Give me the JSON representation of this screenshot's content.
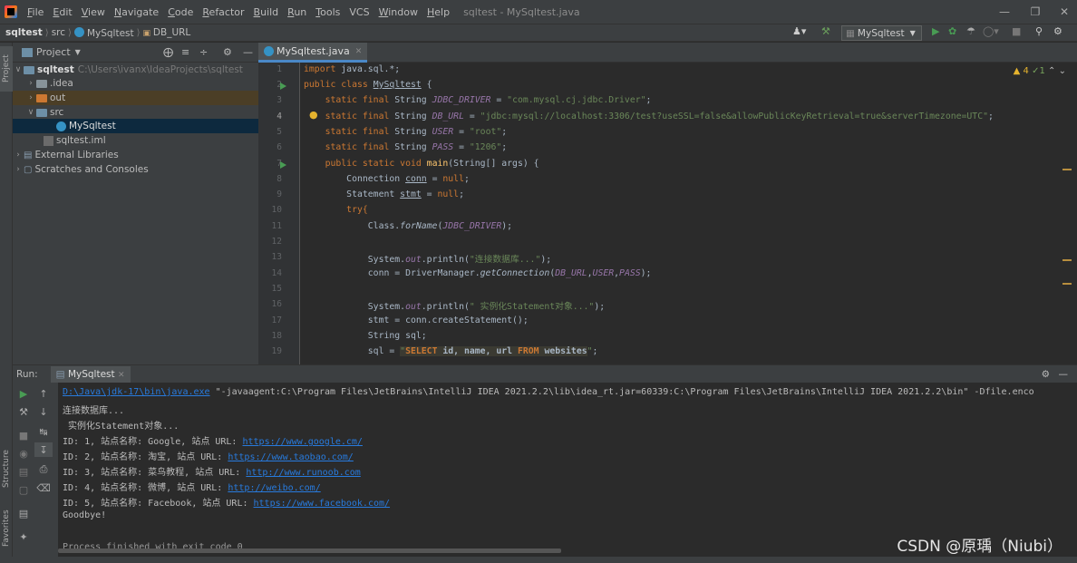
{
  "menubar": {
    "items": [
      "File",
      "Edit",
      "View",
      "Navigate",
      "Code",
      "Refactor",
      "Build",
      "Run",
      "Tools",
      "VCS",
      "Window",
      "Help"
    ],
    "title": "sqltest - MySqltest.java"
  },
  "navbar": {
    "project": "sqltest",
    "src": "src",
    "cls": "MySqltest",
    "field": "DB_URL",
    "run_config": "MySqltest"
  },
  "left_tabs": {
    "project": "Project",
    "structure": "Structure",
    "favorites": "Favorites"
  },
  "project_panel": {
    "title": "Project",
    "tree": [
      {
        "label": "sqltest",
        "path": "C:\\Users\\ivanx\\IdeaProjects\\sqltest"
      },
      {
        "label": ".idea"
      },
      {
        "label": "out"
      },
      {
        "label": "src"
      },
      {
        "label": "MySqltest"
      },
      {
        "label": "sqltest.iml"
      },
      {
        "label": "External Libraries"
      },
      {
        "label": "Scratches and Consoles"
      }
    ]
  },
  "editor": {
    "tab": "MySqltest.java",
    "inspections": {
      "warnings": "4",
      "ok": "1"
    },
    "lines": [
      "1",
      "2",
      "3",
      "4",
      "5",
      "6",
      "7",
      "8",
      "9",
      "10",
      "11",
      "12",
      "13",
      "14",
      "15",
      "16",
      "17",
      "18",
      "19"
    ],
    "code": {
      "l1a": "import",
      "l1b": " java.sql.*;",
      "l2a": "public class ",
      "l2b": "MySqltest",
      " l2c": " {",
      "l3a": "    static final ",
      "l3b": "String ",
      "l3c": "JDBC_DRIVER",
      " l3d": " = ",
      "l3e": "\"com.mysql.cj.jdbc.Driver\"",
      "l3f": ";",
      "l4c": "DB_URL",
      "l4e": "\"jdbc:mysql://localhost:3306/test?useSSL=false&allowPublicKeyRetrieval=true&serverTimezone=UTC\"",
      "l5c": "USER",
      "l5e": "\"root\"",
      "l6c": "PASS",
      "l6e": "\"1206\"",
      "l7a": "    public static void ",
      "l7b": "main",
      "l7c": "(String[] args) {",
      "l8a": "        Connection ",
      "l8b": "conn",
      " l8c": " = ",
      "l8d": "null",
      "l9a": "        Statement ",
      "l9b": "stmt",
      "l10": "        try{",
      "l11a": "            Class.",
      "l11b": "forName",
      "l11c": "(",
      "l11d": "JDBC_DRIVER",
      "l11e": ");",
      "l13a": "            System.",
      "l13b": "out",
      "l13c": ".println(",
      "l13d": "\"连接数据库...\"",
      "l13e": ");",
      "l14a": "            conn = DriverManager.",
      "l14b": "getConnection",
      "l14c": "(",
      "l14d": "DB_URL",
      "l14e": ",",
      "l14f": "USER",
      "l14g": ",",
      "l14h": "PASS",
      "l14i": ");",
      "l16d": "\" 实例化Statement对象...\"",
      "l17": "            stmt = conn.createStatement();",
      "l18": "            String sql;",
      "l19a": "            sql = ",
      "l19b": "\"",
      "l19c": "SELECT",
      " l19d": " id, name, url ",
      "l19e": "FROM",
      " l19f": " websites",
      "l19g": "\"",
      "l19h": ";"
    }
  },
  "run_panel": {
    "label": "Run:",
    "tab": "MySqltest",
    "console": {
      "cmd_link": "D:\\Java\\jdk-17\\bin\\java.exe",
      "cmd_rest": " \"-javaagent:C:\\Program Files\\JetBrains\\IntelliJ IDEA 2021.2.2\\lib\\idea_rt.jar=60339:C:\\Program Files\\JetBrains\\IntelliJ IDEA 2021.2.2\\bin\" -Dfile.enco",
      "o1": "连接数据库...",
      "o2": " 实例化Statement对象...",
      "rows": [
        {
          "prefix": "ID: 1, 站点名称: Google, 站点 URL: ",
          "url": "https://www.google.cm/"
        },
        {
          "prefix": "ID: 2, 站点名称: 淘宝, 站点 URL: ",
          "url": "https://www.taobao.com/"
        },
        {
          "prefix": "ID: 3, 站点名称: 菜鸟教程, 站点 URL: ",
          "url": "http://www.runoob.com"
        },
        {
          "prefix": "ID: 4, 站点名称: 微博, 站点 URL: ",
          "url": "http://weibo.com/"
        },
        {
          "prefix": "ID: 5, 站点名称: Facebook, 站点 URL: ",
          "url": "https://www.facebook.com/"
        }
      ],
      "goodbye": "Goodbye!",
      "exit": "Process finished with exit code 0"
    }
  },
  "watermark": "CSDN @原瑀（Niubi）",
  "colors": {
    "keyword": "#cc7832",
    "string": "#6a8759",
    "field": "#9876aa",
    "method": "#ffc66d",
    "link": "#287bde",
    "run": "#499c54"
  }
}
